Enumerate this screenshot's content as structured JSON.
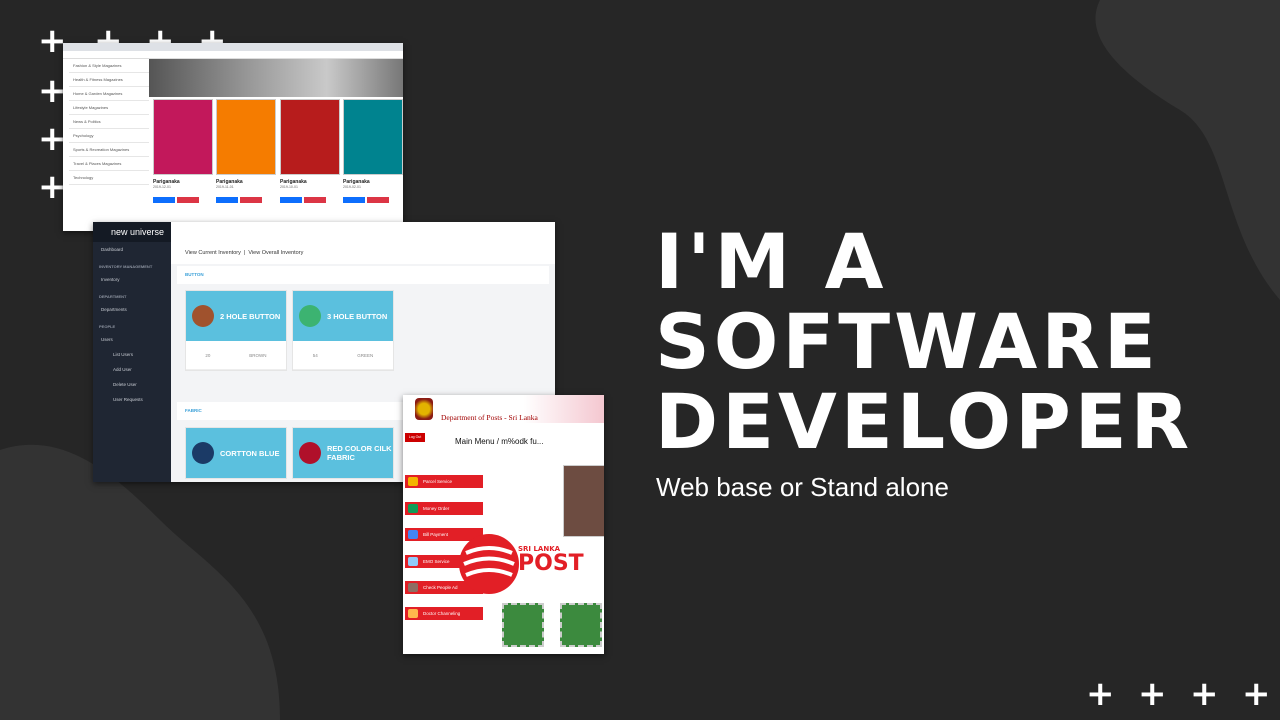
{
  "colors": {
    "background": "#262626",
    "blob": "#333333",
    "accent_blue": "#5bc0de",
    "post_red": "#e21f26"
  },
  "headline": {
    "lines": [
      "I'M A",
      "SOFTWARE",
      "DEVELOPER"
    ]
  },
  "subheadline": "Web base or Stand alone",
  "decorations": {
    "plus_glyph": "+"
  },
  "magazine_shop": {
    "categories": [
      "Fashion & Style Magazines",
      "Health & Fitness Magazines",
      "Home & Garden Magazines",
      "Lifestyle Magazines",
      "News & Politics",
      "Psychology",
      "Sports & Recreation Magazines",
      "Travel & Places Magazines",
      "Technology"
    ],
    "products": [
      {
        "title": "Pariganaka",
        "date": "2019-12-01",
        "cover": "#c2185b"
      },
      {
        "title": "Pariganaka",
        "date": "2019-11-01",
        "cover": "#f57c00"
      },
      {
        "title": "Pariganaka",
        "date": "2019-10-01",
        "cover": "#b71c1c"
      },
      {
        "title": "Pariganaka",
        "date": "2019-02-01",
        "cover": "#00838f"
      }
    ],
    "buttons": {
      "subscribe": "Subscribe",
      "add_to_cart": "Add to cart"
    }
  },
  "inventory_app": {
    "logo": "new universe",
    "sidebar": {
      "dashboard": "Dashboard",
      "section_inventory": "INVENTORY MANAGEMENT",
      "inventory": "Inventory",
      "section_department": "DEPARTMENT",
      "departments": "Departments",
      "section_people": "PEOPLE",
      "users": "Users",
      "user_items": [
        "List Users",
        "Add User",
        "Delete User",
        "User Requests"
      ]
    },
    "subnav": {
      "current": "View Current Inventory",
      "overall": "View Overall Inventory"
    },
    "sections": [
      {
        "title": "BUTTON",
        "items": [
          {
            "name": "2 HOLE BUTTON",
            "qty": "20",
            "color": "BROWN",
            "swatch": "#a0522d"
          },
          {
            "name": "3 HOLE BUTTON",
            "qty": "54",
            "color": "GREEN",
            "swatch": "#3cb371"
          }
        ]
      },
      {
        "title": "FABRIC",
        "items": [
          {
            "name": "CORTTON BLUE",
            "swatch": "#1b3a66"
          },
          {
            "name": "RED COLOR CILK FABRIC",
            "swatch": "#b0102a"
          }
        ]
      }
    ]
  },
  "post_app": {
    "header_dept": "Department of Posts - Sri Lanka",
    "menu_title": "Main Menu / m%odk fu...",
    "logout": "Log Out",
    "menu_items": [
      {
        "label": "Parcel Service",
        "icon": "#f4b400"
      },
      {
        "label": "Money Order",
        "icon": "#0f9d58"
      },
      {
        "label": "Bill Payment",
        "icon": "#4285f4"
      },
      {
        "label": "EMO Service",
        "icon": "#90caf9"
      },
      {
        "label": "Check People Ad",
        "icon": "#8d6e63"
      },
      {
        "label": "Doctor Channeling",
        "icon": "#ffb74d"
      }
    ],
    "logo_small": "SRI LANKA",
    "logo_big": "POST"
  }
}
